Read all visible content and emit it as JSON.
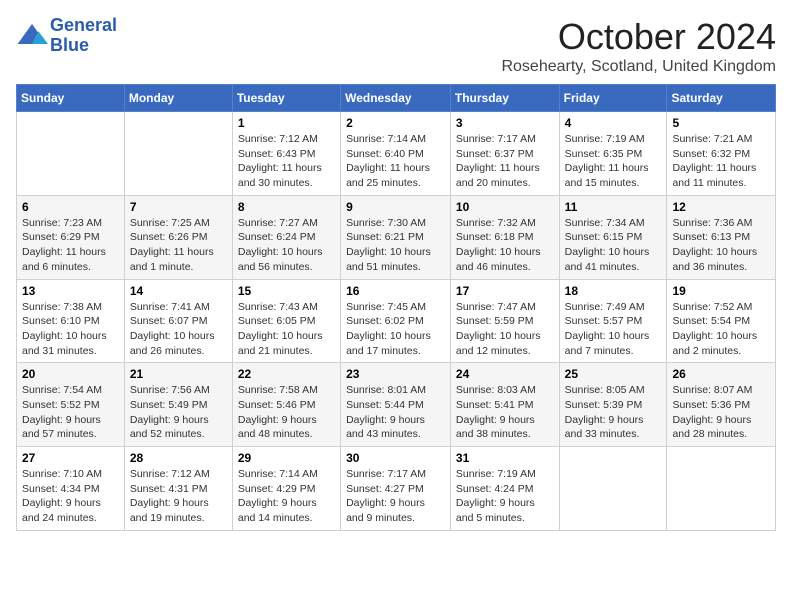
{
  "header": {
    "logo_line1": "General",
    "logo_line2": "Blue",
    "month_title": "October 2024",
    "location": "Rosehearty, Scotland, United Kingdom"
  },
  "days_of_week": [
    "Sunday",
    "Monday",
    "Tuesday",
    "Wednesday",
    "Thursday",
    "Friday",
    "Saturday"
  ],
  "weeks": [
    [
      {
        "day": "",
        "detail": ""
      },
      {
        "day": "",
        "detail": ""
      },
      {
        "day": "1",
        "detail": "Sunrise: 7:12 AM\nSunset: 6:43 PM\nDaylight: 11 hours and 30 minutes."
      },
      {
        "day": "2",
        "detail": "Sunrise: 7:14 AM\nSunset: 6:40 PM\nDaylight: 11 hours and 25 minutes."
      },
      {
        "day": "3",
        "detail": "Sunrise: 7:17 AM\nSunset: 6:37 PM\nDaylight: 11 hours and 20 minutes."
      },
      {
        "day": "4",
        "detail": "Sunrise: 7:19 AM\nSunset: 6:35 PM\nDaylight: 11 hours and 15 minutes."
      },
      {
        "day": "5",
        "detail": "Sunrise: 7:21 AM\nSunset: 6:32 PM\nDaylight: 11 hours and 11 minutes."
      }
    ],
    [
      {
        "day": "6",
        "detail": "Sunrise: 7:23 AM\nSunset: 6:29 PM\nDaylight: 11 hours and 6 minutes."
      },
      {
        "day": "7",
        "detail": "Sunrise: 7:25 AM\nSunset: 6:26 PM\nDaylight: 11 hours and 1 minute."
      },
      {
        "day": "8",
        "detail": "Sunrise: 7:27 AM\nSunset: 6:24 PM\nDaylight: 10 hours and 56 minutes."
      },
      {
        "day": "9",
        "detail": "Sunrise: 7:30 AM\nSunset: 6:21 PM\nDaylight: 10 hours and 51 minutes."
      },
      {
        "day": "10",
        "detail": "Sunrise: 7:32 AM\nSunset: 6:18 PM\nDaylight: 10 hours and 46 minutes."
      },
      {
        "day": "11",
        "detail": "Sunrise: 7:34 AM\nSunset: 6:15 PM\nDaylight: 10 hours and 41 minutes."
      },
      {
        "day": "12",
        "detail": "Sunrise: 7:36 AM\nSunset: 6:13 PM\nDaylight: 10 hours and 36 minutes."
      }
    ],
    [
      {
        "day": "13",
        "detail": "Sunrise: 7:38 AM\nSunset: 6:10 PM\nDaylight: 10 hours and 31 minutes."
      },
      {
        "day": "14",
        "detail": "Sunrise: 7:41 AM\nSunset: 6:07 PM\nDaylight: 10 hours and 26 minutes."
      },
      {
        "day": "15",
        "detail": "Sunrise: 7:43 AM\nSunset: 6:05 PM\nDaylight: 10 hours and 21 minutes."
      },
      {
        "day": "16",
        "detail": "Sunrise: 7:45 AM\nSunset: 6:02 PM\nDaylight: 10 hours and 17 minutes."
      },
      {
        "day": "17",
        "detail": "Sunrise: 7:47 AM\nSunset: 5:59 PM\nDaylight: 10 hours and 12 minutes."
      },
      {
        "day": "18",
        "detail": "Sunrise: 7:49 AM\nSunset: 5:57 PM\nDaylight: 10 hours and 7 minutes."
      },
      {
        "day": "19",
        "detail": "Sunrise: 7:52 AM\nSunset: 5:54 PM\nDaylight: 10 hours and 2 minutes."
      }
    ],
    [
      {
        "day": "20",
        "detail": "Sunrise: 7:54 AM\nSunset: 5:52 PM\nDaylight: 9 hours and 57 minutes."
      },
      {
        "day": "21",
        "detail": "Sunrise: 7:56 AM\nSunset: 5:49 PM\nDaylight: 9 hours and 52 minutes."
      },
      {
        "day": "22",
        "detail": "Sunrise: 7:58 AM\nSunset: 5:46 PM\nDaylight: 9 hours and 48 minutes."
      },
      {
        "day": "23",
        "detail": "Sunrise: 8:01 AM\nSunset: 5:44 PM\nDaylight: 9 hours and 43 minutes."
      },
      {
        "day": "24",
        "detail": "Sunrise: 8:03 AM\nSunset: 5:41 PM\nDaylight: 9 hours and 38 minutes."
      },
      {
        "day": "25",
        "detail": "Sunrise: 8:05 AM\nSunset: 5:39 PM\nDaylight: 9 hours and 33 minutes."
      },
      {
        "day": "26",
        "detail": "Sunrise: 8:07 AM\nSunset: 5:36 PM\nDaylight: 9 hours and 28 minutes."
      }
    ],
    [
      {
        "day": "27",
        "detail": "Sunrise: 7:10 AM\nSunset: 4:34 PM\nDaylight: 9 hours and 24 minutes."
      },
      {
        "day": "28",
        "detail": "Sunrise: 7:12 AM\nSunset: 4:31 PM\nDaylight: 9 hours and 19 minutes."
      },
      {
        "day": "29",
        "detail": "Sunrise: 7:14 AM\nSunset: 4:29 PM\nDaylight: 9 hours and 14 minutes."
      },
      {
        "day": "30",
        "detail": "Sunrise: 7:17 AM\nSunset: 4:27 PM\nDaylight: 9 hours and 9 minutes."
      },
      {
        "day": "31",
        "detail": "Sunrise: 7:19 AM\nSunset: 4:24 PM\nDaylight: 9 hours and 5 minutes."
      },
      {
        "day": "",
        "detail": ""
      },
      {
        "day": "",
        "detail": ""
      }
    ]
  ]
}
